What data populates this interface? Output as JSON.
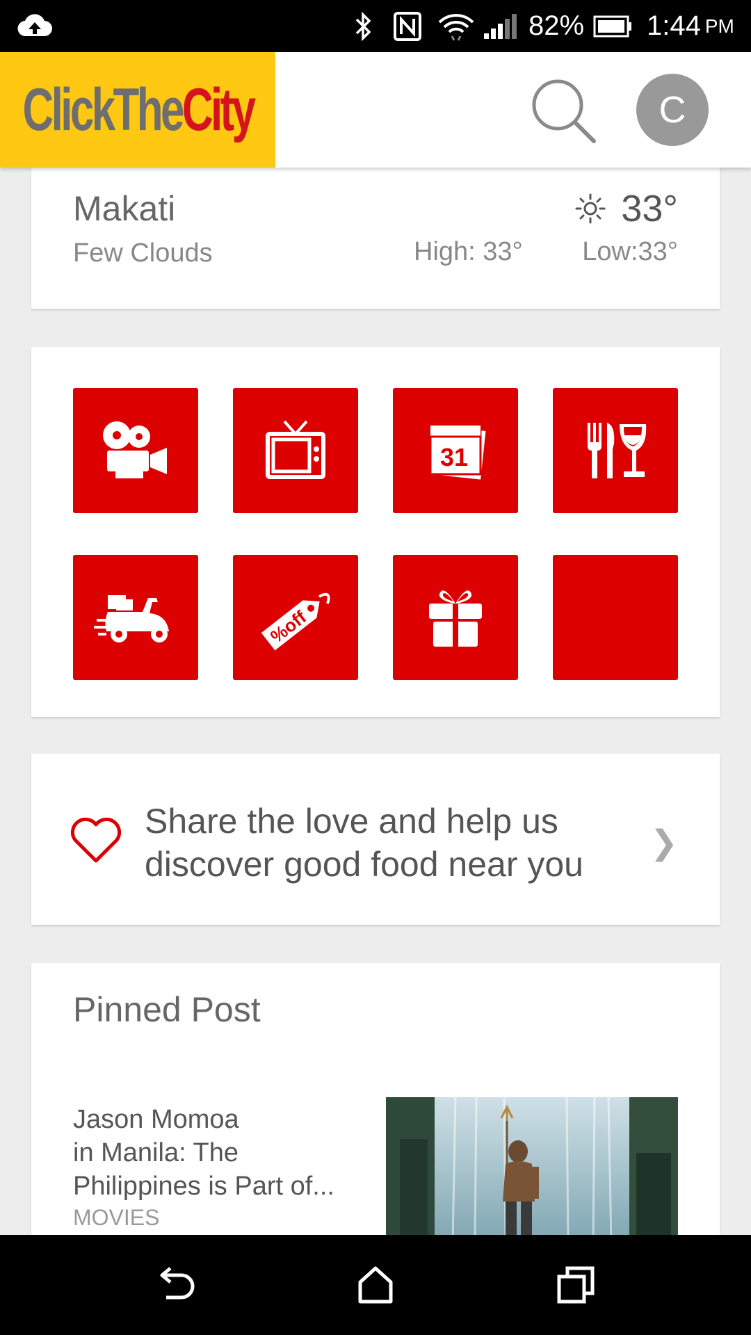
{
  "status_bar": {
    "battery": "82%",
    "time": "1:44",
    "ampm": "PM",
    "icons": [
      "cloud-upload-icon",
      "bluetooth-icon",
      "nfc-icon",
      "wifi-icon",
      "signal-icon",
      "battery-icon"
    ]
  },
  "header": {
    "logo": {
      "part1": "Click",
      "part2": "The",
      "part3": "City"
    },
    "avatar_initial": "C",
    "icons": [
      "search-icon"
    ]
  },
  "weather": {
    "city": "Makati",
    "condition": "Few Clouds",
    "temp": "33°",
    "high": "High: 33°",
    "low": "Low:33°",
    "icon": "sun-icon"
  },
  "categories": [
    {
      "icon": "movie-camera-icon"
    },
    {
      "icon": "tv-icon"
    },
    {
      "icon": "calendar-icon",
      "label": "31"
    },
    {
      "icon": "dining-icon"
    },
    {
      "icon": "delivery-scooter-icon"
    },
    {
      "icon": "discount-tag-icon",
      "label": "%off"
    },
    {
      "icon": "gift-icon"
    },
    {
      "icon": "blank"
    }
  ],
  "share": {
    "line1": "Share the love and help us",
    "line2": "discover good food near you",
    "icon": "heart-icon",
    "chevron": "❯"
  },
  "pinned": {
    "heading": "Pinned Post",
    "post": {
      "title_lines": [
        "Jason Momoa",
        "in Manila: The",
        "Philippines is Part of..."
      ],
      "category": "MOVIES"
    }
  },
  "colors": {
    "accent_red": "#dc0000",
    "logo_yellow": "#ffc813"
  }
}
